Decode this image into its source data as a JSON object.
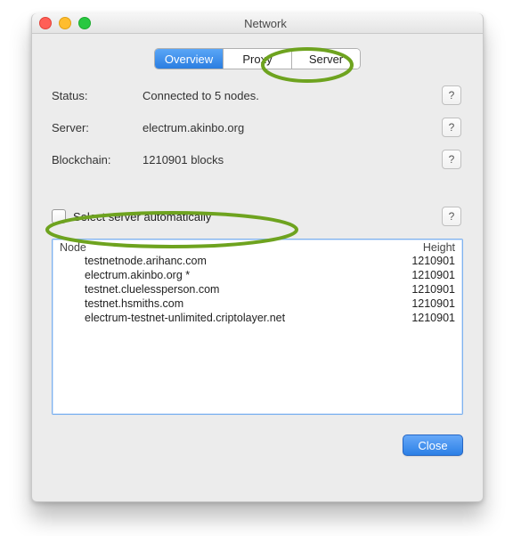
{
  "window": {
    "title": "Network"
  },
  "tabs": {
    "items": [
      "Overview",
      "Proxy",
      "Server"
    ],
    "active_index": 0
  },
  "fields": {
    "status_label": "Status:",
    "status_value": "Connected to 5 nodes.",
    "server_label": "Server:",
    "server_value": "electrum.akinbo.org",
    "blockchain_label": "Blockchain:",
    "blockchain_value": "1210901 blocks"
  },
  "auto": {
    "checkbox_checked": false,
    "label": "Select server automatically"
  },
  "table": {
    "headers": {
      "node": "Node",
      "height": "Height"
    },
    "rows": [
      {
        "node": "testnetnode.arihanc.com",
        "height": "1210901"
      },
      {
        "node": "electrum.akinbo.org *",
        "height": "1210901"
      },
      {
        "node": "testnet.cluelessperson.com",
        "height": "1210901"
      },
      {
        "node": "testnet.hsmiths.com",
        "height": "1210901"
      },
      {
        "node": "electrum-testnet-unlimited.criptolayer.net",
        "height": "1210901"
      }
    ]
  },
  "buttons": {
    "close": "Close",
    "help": "?"
  }
}
